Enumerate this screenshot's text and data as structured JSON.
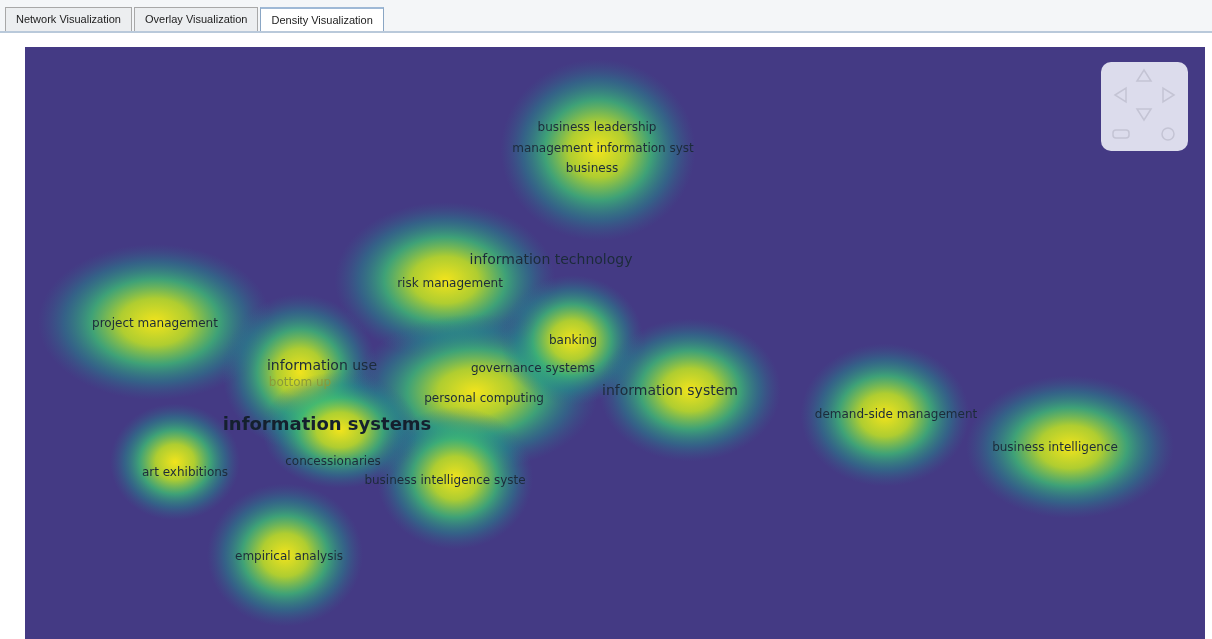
{
  "tabs": [
    {
      "label": "Network Visualization",
      "selected": false
    },
    {
      "label": "Overlay Visualization",
      "selected": false
    },
    {
      "label": "Density Visualization",
      "selected": true
    }
  ],
  "density_map": {
    "terms": [
      {
        "label": "business leadership"
      },
      {
        "label": "management information syst"
      },
      {
        "label": "business"
      },
      {
        "label": "information technology"
      },
      {
        "label": "risk management"
      },
      {
        "label": "project management"
      },
      {
        "label": "information use"
      },
      {
        "label": "bottom up"
      },
      {
        "label": "banking"
      },
      {
        "label": "governance systems"
      },
      {
        "label": "information system"
      },
      {
        "label": "personal computing"
      },
      {
        "label": "information systems"
      },
      {
        "label": "demand-side management"
      },
      {
        "label": "business intelligence"
      },
      {
        "label": "art exhibitions"
      },
      {
        "label": "concessionaries"
      },
      {
        "label": "business intelligence syste"
      },
      {
        "label": "empirical analysis"
      }
    ]
  }
}
